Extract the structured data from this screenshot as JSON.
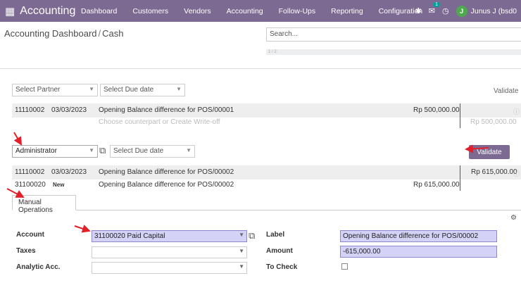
{
  "topbar": {
    "grid_icon": "apps-grid-icon",
    "app_name": "Accounting",
    "nav": [
      "Dashboard",
      "Customers",
      "Vendors",
      "Accounting",
      "Follow-Ups",
      "Reporting",
      "Configuration"
    ],
    "chat_badge": "1",
    "avatar_initial": "J",
    "user_name": "Junus J (bsd0"
  },
  "breadcrumb": {
    "parent": "Accounting Dashboard",
    "separator": "/",
    "current": "Cash"
  },
  "search": {
    "placeholder": "Search..."
  },
  "progress": {
    "label": "1 / 2"
  },
  "line1": {
    "partner_placeholder": "Select Partner",
    "due_placeholder": "Select Due date",
    "validate_label": "Validate",
    "code": "11110002",
    "date": "03/03/2023",
    "description": "Opening Balance difference for POS/00001",
    "amount": "Rp 500,000.00",
    "counterpart_hint": "Choose counterpart or Create Write-off",
    "balance": "Rp 500,000.00"
  },
  "line2": {
    "partner_value": "Administrator",
    "due_placeholder": "Select Due date",
    "validate_label": "Validate",
    "code": "11110002",
    "date": "03/03/2023",
    "description": "Opening Balance difference for POS/00002",
    "right_amount": "Rp 615,000.00",
    "new_code": "31100020",
    "new_tag": "New",
    "new_description": "Opening Balance difference for POS/00002",
    "new_amount": "Rp 615,000.00"
  },
  "manual": {
    "tab_label": "Manual Operations",
    "account_label": "Account",
    "account_value": "31100020 Paid Capital",
    "taxes_label": "Taxes",
    "analytic_label": "Analytic Acc.",
    "label_label": "Label",
    "label_value": "Opening Balance difference for POS/00002",
    "amount_label": "Amount",
    "amount_value": "-615,000.00",
    "tocheck_label": "To Check"
  },
  "colors": {
    "topbar": "#7c6a92",
    "highlight": "#d4d2f6",
    "arrow": "#e0202a"
  }
}
